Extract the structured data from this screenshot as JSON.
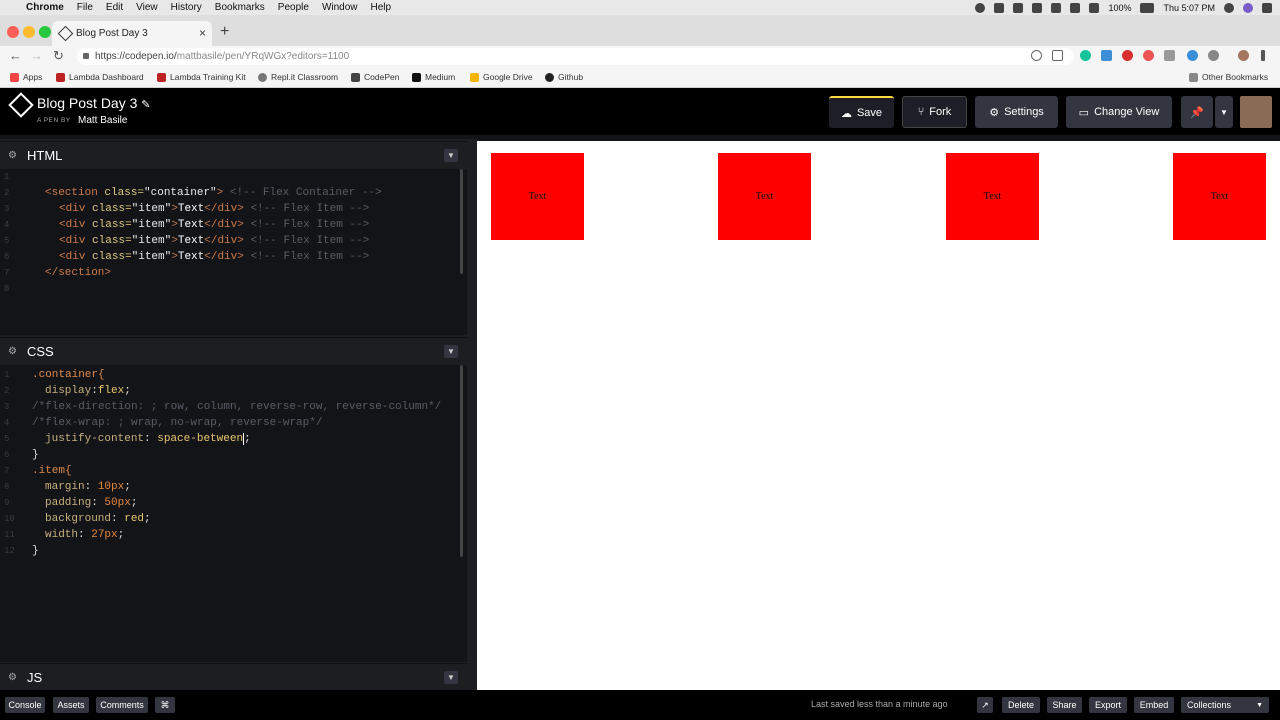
{
  "menubar": {
    "app": "Chrome",
    "items": [
      "File",
      "Edit",
      "View",
      "History",
      "Bookmarks",
      "People",
      "Window",
      "Help"
    ],
    "battery": "100%",
    "clock": "Thu 5:07 PM"
  },
  "browser": {
    "tab_title": "Blog Post Day 3",
    "url_host": "https://codepen.io/",
    "url_path": "mattbasile/pen/YRqWGx?editors=1100",
    "bookmarks": [
      "Apps",
      "Lambda Dashboard",
      "Lambda Training Kit",
      "Repl.it Classroom",
      "CodePen",
      "Medium",
      "Google Drive",
      "Github"
    ],
    "other_bookmarks": "Other Bookmarks"
  },
  "header": {
    "title": "Blog Post Day 3",
    "by_label": "A PEN BY",
    "author": "Matt Basile",
    "save": "Save",
    "fork": "Fork",
    "settings": "Settings",
    "change_view": "Change View"
  },
  "editors": {
    "html_label": "HTML",
    "css_label": "CSS",
    "js_label": "JS",
    "html_line_numbers": [
      "1",
      "2",
      "3",
      "4",
      "5",
      "6",
      "7",
      "8"
    ],
    "css_line_numbers": [
      "1",
      "2",
      "3",
      "4",
      "5",
      "6",
      "7",
      "8",
      "9",
      "10",
      "11",
      "12"
    ],
    "html_code": {
      "l2_open": "<section ",
      "l2_attr": "class=",
      "l2_val": "\"container\"",
      "l2_end": ">",
      "l2_cmt": " <!-- Flex Container -->",
      "div_open": "<div ",
      "div_attr": "class=",
      "div_val": "\"item\"",
      "div_gt": ">",
      "div_text": "Text",
      "div_close": "</div>",
      "div_cmt": " <!-- Flex Item -->",
      "l7": "</section>"
    },
    "css_code": {
      "l1": ".container{",
      "l2_prop": "display",
      "l2_val": "flex",
      "l3": "/*flex-direction: ; row, column, reverse-row, reverse-column*/",
      "l4": "/*flex-wrap: ; wrap, no-wrap, reverse-wrap*/",
      "l5_prop": "justify-content",
      "l5_val": "space-between",
      "l6": "}",
      "l7": ".item{",
      "l8_prop": "margin",
      "l8_val": "10px",
      "l9_prop": "padding",
      "l9_val": "50px",
      "l10_prop": "background",
      "l10_val": "red",
      "l11_prop": "width",
      "l11_val": "27px",
      "l12": "}"
    }
  },
  "preview": {
    "items": [
      "Text",
      "Text",
      "Text",
      "Text"
    ],
    "item_color": "#ff0000"
  },
  "footer": {
    "console": "Console",
    "assets": "Assets",
    "comments": "Comments",
    "shortcut": "⌘",
    "last_saved": "Last saved less than a minute ago",
    "delete": "Delete",
    "share": "Share",
    "export": "Export",
    "embed": "Embed",
    "collections": "Collections"
  }
}
